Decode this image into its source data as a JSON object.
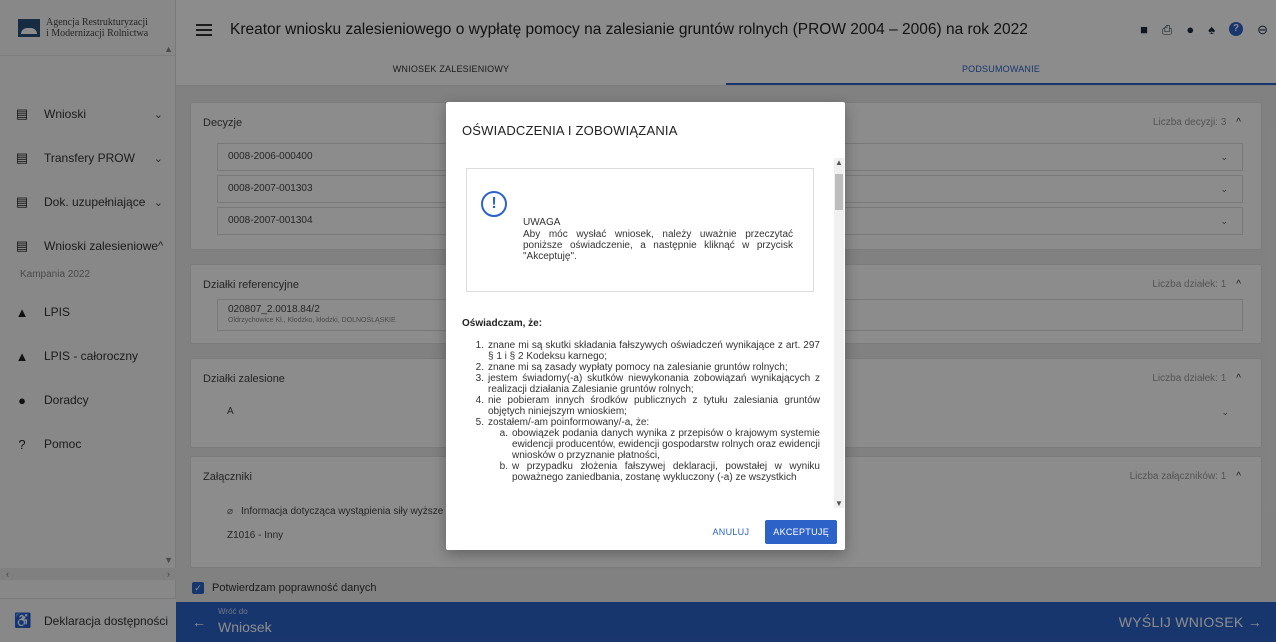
{
  "brand": {
    "line1": "Agencja Restrukturyzacji",
    "line2": "i Modernizacji Rolnictwa"
  },
  "sidebar": {
    "items": [
      {
        "label": "Wnioski",
        "icon": "clipboard-icon",
        "chevron": "⌄"
      },
      {
        "label": "Transfery PROW",
        "icon": "clipboard-icon",
        "chevron": "⌄"
      },
      {
        "label": "Dok. uzupełniające",
        "icon": "clipboard-icon",
        "chevron": "⌄"
      },
      {
        "label": "Wnioski zalesieniowe",
        "icon": "clipboard-icon",
        "chevron": "^"
      }
    ],
    "sub_label": "Kampania 2022",
    "items2": [
      {
        "label": "LPIS",
        "icon": "mountain-icon"
      },
      {
        "label": "LPIS - całoroczny",
        "icon": "mountain-icon"
      },
      {
        "label": "Doradcy",
        "icon": "person-icon"
      },
      {
        "label": "Pomoc",
        "icon": "help-icon"
      }
    ],
    "bottom_label": "Deklaracja dostępności"
  },
  "header": {
    "title": "Kreator wniosku zalesieniowego o wypłatę pomocy na zalesianie gruntów rolnych (PROW 2004 – 2006) na rok 2022",
    "icons": [
      "save-icon",
      "print-icon",
      "alert-icon",
      "bell-icon",
      "help-icon",
      "account-icon"
    ]
  },
  "tabs": [
    {
      "label": "WNIOSEK ZALESIENIOWY",
      "active": false
    },
    {
      "label": "PODSUMOWANIE",
      "active": true
    }
  ],
  "cards": {
    "decyzje": {
      "title": "Decyzje",
      "count": "Liczba decyzji: 3",
      "rows": [
        "0008-2006-000400",
        "0008-2007-001303",
        "0008-2007-001304"
      ]
    },
    "dzialki_ref": {
      "title": "Działki referencyjne",
      "count": "Liczba działek: 1",
      "row_main": "020807_2.0018.84/2",
      "row_sub": "Oldrzychowice Kł., Kłodzko, kłodzki, DOLNOŚLĄSKIE"
    },
    "dzialki_zal": {
      "title": "Działki zalesione",
      "count": "Liczba działek: 1",
      "row": "A"
    },
    "zalaczniki": {
      "title": "Załączniki",
      "count": "Liczba załączników: 1",
      "row1": "Informacja dotycząca wystąpienia siły wyższe",
      "row2": "Z1016 - Inny"
    }
  },
  "confirm_label": "Potwierdzam poprawność danych",
  "footer": {
    "back_small": "Wróć do",
    "back_big": "Wniosek",
    "send": "WYŚLIJ WNIOSEK"
  },
  "modal": {
    "title": "OŚWIADCZENIA I ZOBOWIĄZANIA",
    "notice_title": "UWAGA",
    "notice_body": "Aby móc wysłać wniosek, należy uważnie przeczytać poniższe oświadczenie, a następnie kliknąć w przycisk \"Akceptuję\".",
    "decl_head": "Oświadczam, że:",
    "items": [
      {
        "n": "1.",
        "t": "znane mi są skutki składania fałszywych oświadczeń wynikające z art. 297 § 1 i § 2 Kodeksu karnego;"
      },
      {
        "n": "2.",
        "t": "znane mi są zasady wypłaty pomocy na zalesianie gruntów rolnych;"
      },
      {
        "n": "3.",
        "t": "jestem świadomy(-a) skutków niewykonania zobowiązań wynikających z realizacji działania Zalesianie gruntów rolnych;"
      },
      {
        "n": "4.",
        "t": "nie pobieram innych środków publicznych z tytułu zalesiania gruntów objętych niniejszym wnioskiem;"
      },
      {
        "n": "5.",
        "t": "zostałem/-am poinformowany/-a, że:"
      }
    ],
    "sub_items": [
      {
        "n": "a.",
        "t": "obowiązek podania danych wynika z przepisów o krajowym systemie ewidencji producentów, ewidencji gospodarstw rolnych oraz ewidencji wniosków o przyznanie płatności,"
      },
      {
        "n": "b.",
        "t": "w przypadku złożenia fałszywej deklaracji, powstałej w wyniku poważnego zaniedbania, zostanę wykluczony (-a) ze wszystkich"
      }
    ],
    "cancel_label": "ANULUJ",
    "accept_label": "AKCEPTUJĘ"
  }
}
